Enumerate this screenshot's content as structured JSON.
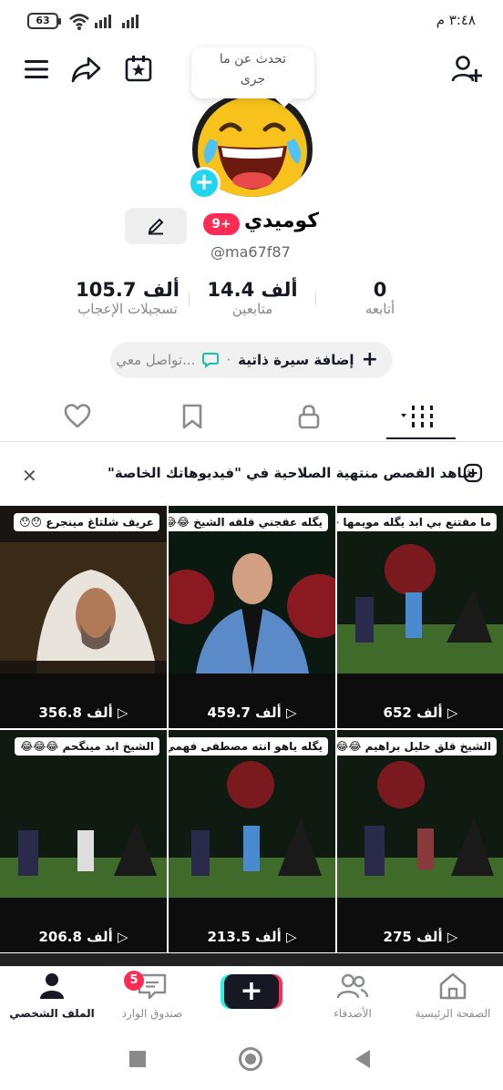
{
  "status_bar": {
    "battery": "63",
    "time": "٣:٤٨ م"
  },
  "top_bar": {
    "icons": [
      "menu-icon",
      "share-icon",
      "calendar-star-icon",
      "add-friend-icon"
    ]
  },
  "profile": {
    "note_bubble": "تحدث عن ما جرى",
    "notification_badge": "9+",
    "name": "كوميدي",
    "handle": "@ma67f87",
    "stats": {
      "following": {
        "value": "0",
        "label": "أتابعه"
      },
      "followers": {
        "value": "14.4 ألف",
        "label": "متابعين"
      },
      "likes": {
        "value": "105.7 ألف",
        "label": "تسجيلات الإعجاب"
      }
    },
    "bio_add_label": "إضافة سيرة ذاتية",
    "connect_label": "تواصل معي...",
    "bio_separator": "·"
  },
  "tabs": [
    {
      "name": "videos",
      "icon": "grid-icon",
      "active": true
    },
    {
      "name": "private",
      "icon": "lock-icon",
      "active": false
    },
    {
      "name": "favorites",
      "icon": "bookmark-icon",
      "active": false
    },
    {
      "name": "liked",
      "icon": "heart-icon",
      "active": false
    }
  ],
  "banner": {
    "text": "شاهد القصص منتهية الصلاحية في \"فيديوهاتك الخاصة\""
  },
  "videos": [
    {
      "caption": "ما مقتنع بي ابد يگله مويمها 😂",
      "views": "652 ألف"
    },
    {
      "caption": "يگله عقجني قلقه الشيخ 😂😂😂",
      "views": "459.7 ألف"
    },
    {
      "caption": "عريف شلتاغ مينجرع 😯😯",
      "views": "356.8 ألف"
    },
    {
      "caption": "الشيخ قلق خليل براهيم 😂😂",
      "views": "275 ألف"
    },
    {
      "caption": "يگله ياهو انته مصطفى فهمي 😂",
      "views": "213.5 ألف"
    },
    {
      "caption": "الشيخ ابد مينگحم 😂😂😂",
      "views": "206.8 ألف"
    }
  ],
  "bottom_nav": {
    "home": "الصفحة الرئيسية",
    "friends": "الأصدقاء",
    "inbox": "صندوق الوارد",
    "inbox_badge": "5",
    "profile": "الملف الشخصي",
    "post": "+"
  },
  "colors": {
    "accent_red": "#fe2c55",
    "accent_cyan": "#20d5ec",
    "text": "#161823"
  }
}
